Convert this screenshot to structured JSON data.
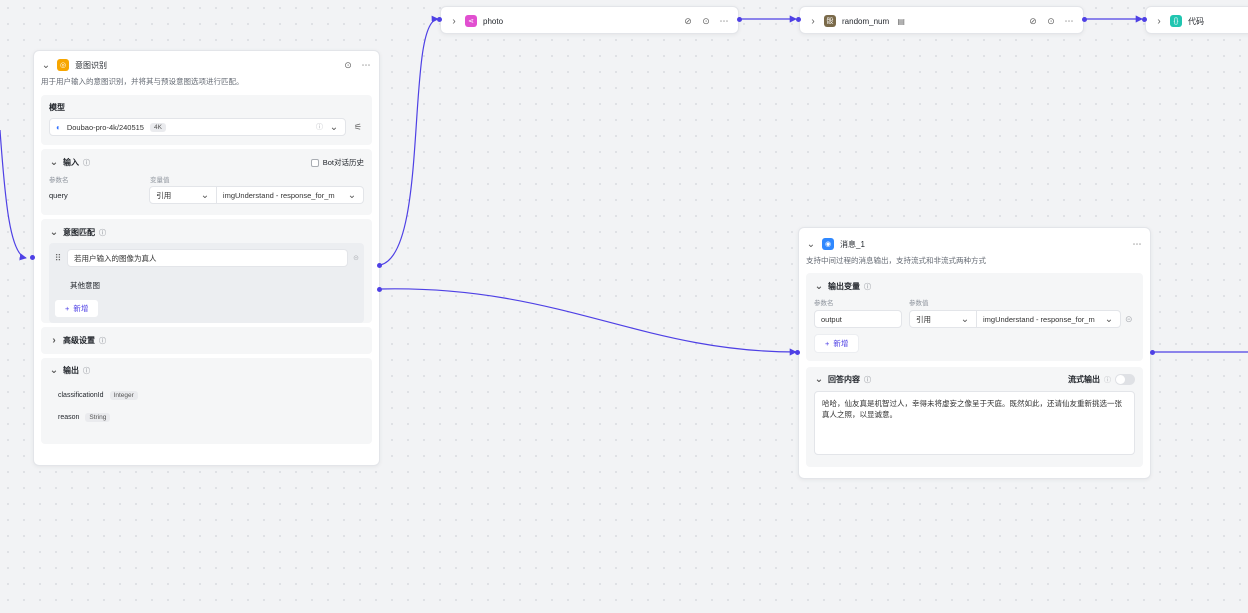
{
  "top_nodes": {
    "photo": {
      "title": "photo"
    },
    "random_num": {
      "title": "random_num"
    },
    "code": {
      "title": "代码"
    }
  },
  "intent_node": {
    "title": "意图识别",
    "description": "用于用户输入的意图识别，并将其与预设意图选项进行匹配。",
    "model": {
      "section_title": "模型",
      "name": "Doubao-pro-4k/240515",
      "badge": "4K"
    },
    "input": {
      "section_title": "输入",
      "bot_history_label": "Bot对话历史",
      "param_col": "参数名",
      "value_col": "变量值",
      "param_name": "query",
      "ref_type": "引用",
      "ref_value": "imgUnderstand - response_for_m"
    },
    "intent_match": {
      "section_title": "意图匹配",
      "option_1": "若用户输入的图像为真人",
      "other": "其他意图",
      "add_label": "新增"
    },
    "advanced": {
      "section_title": "高级设置"
    },
    "output": {
      "section_title": "输出",
      "vars": [
        {
          "name": "classificationId",
          "type": "Integer"
        },
        {
          "name": "reason",
          "type": "String"
        }
      ]
    }
  },
  "message_node": {
    "title": "消息_1",
    "description": "支持中间过程的消息输出，支持流式和非流式两种方式",
    "output_vars": {
      "section_title": "输出变量",
      "param_col": "参数名",
      "value_col": "参数值",
      "param_name": "output",
      "ref_type": "引用",
      "ref_value": "imgUnderstand - response_for_m",
      "add_label": "新增"
    },
    "answer": {
      "section_title": "回答内容",
      "stream_label": "流式输出",
      "content": "哈哈，仙友真是机智过人，幸得未将虚妄之像呈于天庭。既然如此，还请仙友重新挑选一张真人之照，以显诚意。"
    }
  },
  "colors": {
    "accent": "#4e40e5",
    "intent_icon": "#f7a600",
    "photo_icon": "#e14fd0",
    "random_icon": "#7a6a4a",
    "code_icon": "#20c5b0",
    "message_icon": "#2f88ff"
  }
}
